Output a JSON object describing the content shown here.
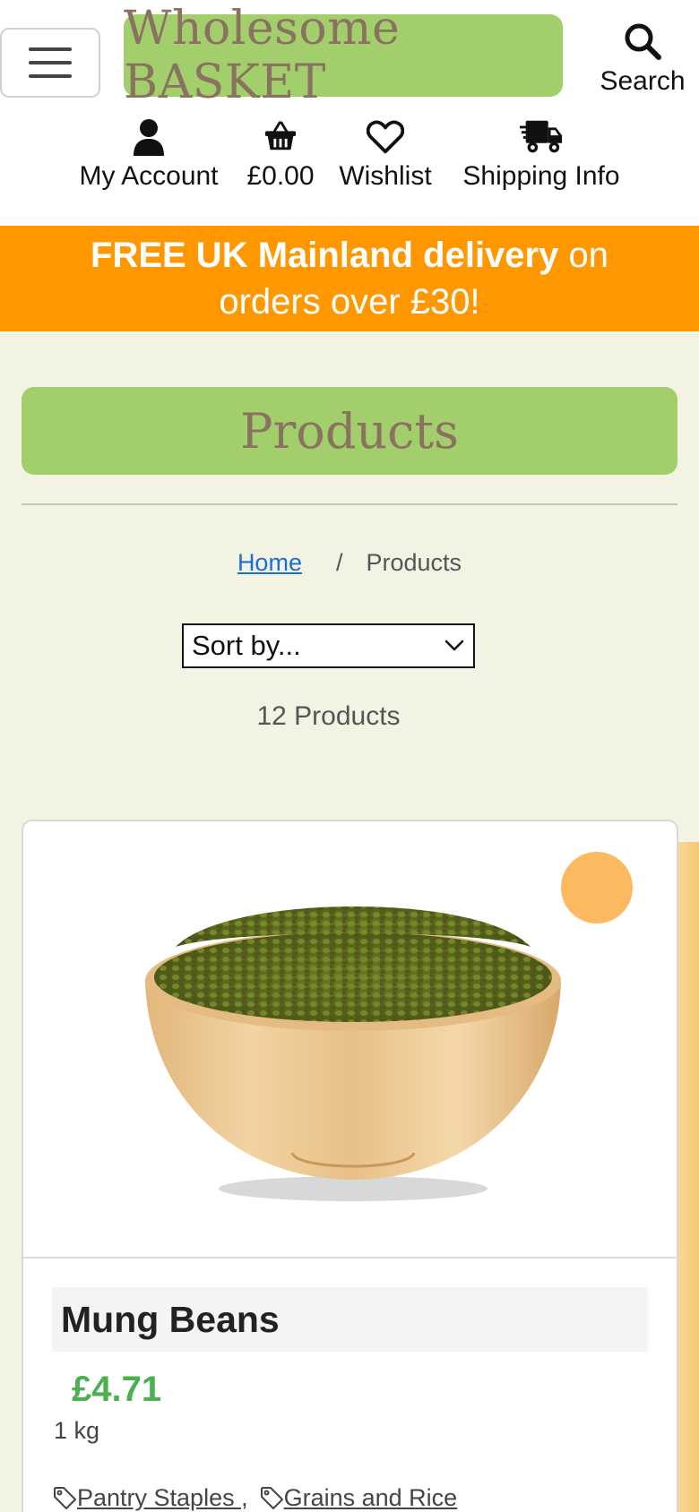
{
  "header": {
    "logo_text": "Wholesome BASKET",
    "search_label": "Search",
    "nav": [
      {
        "label": "My Account",
        "icon": "user-icon"
      },
      {
        "label": "£0.00",
        "icon": "basket-icon"
      },
      {
        "label": "Wishlist",
        "icon": "heart-icon"
      },
      {
        "label": "Shipping Info",
        "icon": "delivery-truck-icon"
      }
    ]
  },
  "banner": {
    "bold": "FREE UK Mainland delivery",
    "rest": " on orders over £30!"
  },
  "page": {
    "title": "Products",
    "breadcrumb": {
      "home": "Home",
      "separator": "/",
      "current": "Products"
    },
    "sort_value": "Sort by...",
    "count_text": "12 Products"
  },
  "product": {
    "name": "Mung Beans",
    "price": "£4.71",
    "weight": "1 kg",
    "tags": [
      "Pantry Staples ,",
      "Grains and Rice"
    ]
  },
  "colors": {
    "brand_green": "#a2ce6b",
    "logo_text": "#8a7260",
    "banner_orange": "#ff9800",
    "price_green": "#4caf50",
    "wishlist_button": "#fdb95f",
    "page_background": "#f3f3e3"
  }
}
